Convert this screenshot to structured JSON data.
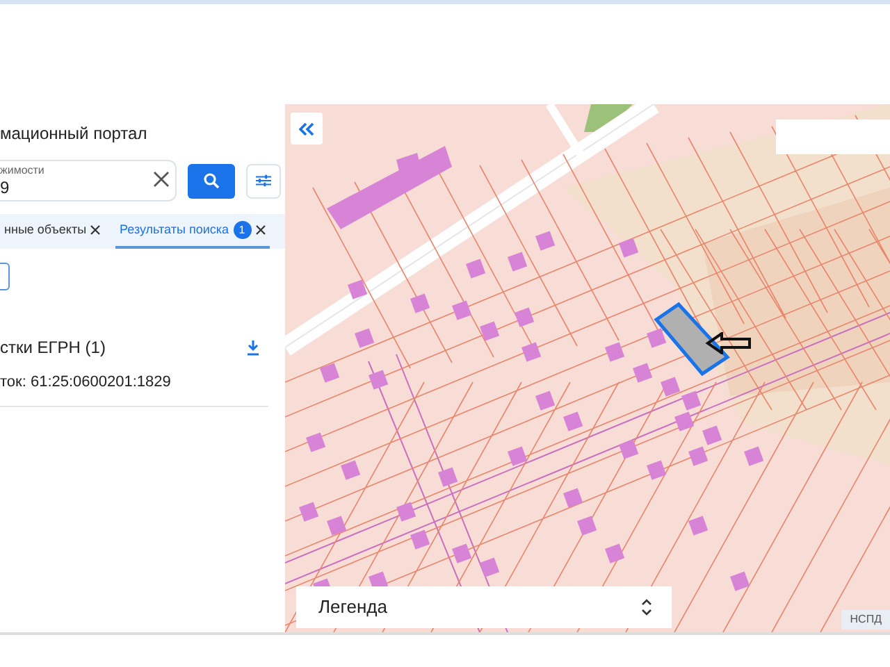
{
  "panel": {
    "title": "мационный портал",
    "search": {
      "label": "жимости",
      "value": "9"
    },
    "tabs": [
      {
        "label": "нные объекты",
        "selected": false
      },
      {
        "label": "Результаты поиска",
        "badge": "1",
        "selected": true
      }
    ],
    "results": {
      "heading": "стки ЕГРН (1)",
      "item": "ток: 61:25:0600201:1829"
    }
  },
  "map": {
    "legend": "Легенда",
    "attribution": "НСПД"
  }
}
